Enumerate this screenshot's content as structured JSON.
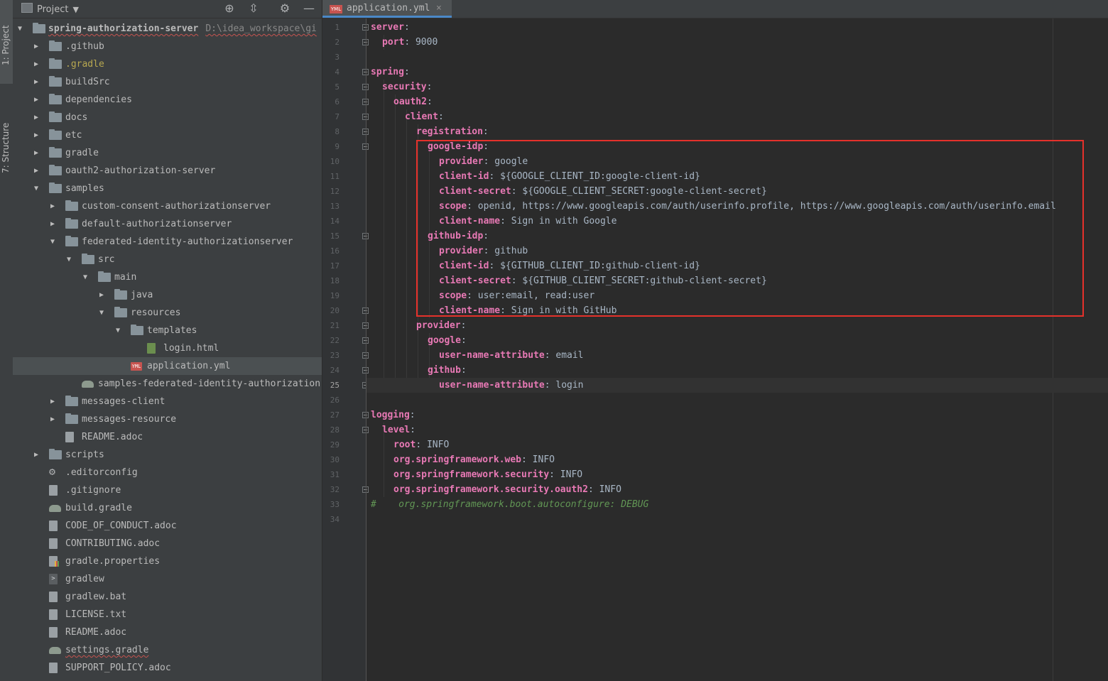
{
  "side_tabs": {
    "project": "1: Project",
    "structure": "7: Structure"
  },
  "project_panel": {
    "title": "Project",
    "root": {
      "name": "spring-authorization-server",
      "path": "D:\\idea_workspace\\gi"
    },
    "tree": [
      {
        "label": ".github"
      },
      {
        "label": ".gradle"
      },
      {
        "label": "buildSrc"
      },
      {
        "label": "dependencies"
      },
      {
        "label": "docs"
      },
      {
        "label": "etc"
      },
      {
        "label": "gradle"
      },
      {
        "label": "oauth2-authorization-server"
      },
      {
        "label": "samples"
      },
      {
        "label": "custom-consent-authorizationserver"
      },
      {
        "label": "default-authorizationserver"
      },
      {
        "label": "federated-identity-authorizationserver"
      },
      {
        "label": "src"
      },
      {
        "label": "main"
      },
      {
        "label": "java"
      },
      {
        "label": "resources"
      },
      {
        "label": "templates"
      },
      {
        "label": "login.html"
      },
      {
        "label": "application.yml"
      },
      {
        "label": "samples-federated-identity-authorization"
      },
      {
        "label": "messages-client"
      },
      {
        "label": "messages-resource"
      },
      {
        "label": "README.adoc"
      },
      {
        "label": "scripts"
      },
      {
        "label": ".editorconfig"
      },
      {
        "label": ".gitignore"
      },
      {
        "label": "build.gradle"
      },
      {
        "label": "CODE_OF_CONDUCT.adoc"
      },
      {
        "label": "CONTRIBUTING.adoc"
      },
      {
        "label": "gradle.properties"
      },
      {
        "label": "gradlew"
      },
      {
        "label": "gradlew.bat"
      },
      {
        "label": "LICENSE.txt"
      },
      {
        "label": "README.adoc"
      },
      {
        "label": "settings.gradle"
      },
      {
        "label": "SUPPORT_POLICY.adoc"
      }
    ]
  },
  "editor": {
    "tab_label": "application.yml",
    "tab_icon_text": "YML",
    "current_line": 25,
    "lines": [
      {
        "n": "1",
        "indent": 0,
        "key": "server",
        "sep": ":",
        "val": ""
      },
      {
        "n": "2",
        "indent": 1,
        "key": "port",
        "sep": ":",
        "val": " 9000"
      },
      {
        "n": "3",
        "indent": 0,
        "key": "",
        "sep": "",
        "val": ""
      },
      {
        "n": "4",
        "indent": 0,
        "key": "spring",
        "sep": ":",
        "val": ""
      },
      {
        "n": "5",
        "indent": 1,
        "key": "security",
        "sep": ":",
        "val": ""
      },
      {
        "n": "6",
        "indent": 2,
        "key": "oauth2",
        "sep": ":",
        "val": ""
      },
      {
        "n": "7",
        "indent": 3,
        "key": "client",
        "sep": ":",
        "val": ""
      },
      {
        "n": "8",
        "indent": 4,
        "key": "registration",
        "sep": ":",
        "val": ""
      },
      {
        "n": "9",
        "indent": 5,
        "key": "google-idp",
        "sep": ":",
        "val": ""
      },
      {
        "n": "10",
        "indent": 6,
        "key": "provider",
        "sep": ":",
        "val": " google"
      },
      {
        "n": "11",
        "indent": 6,
        "key": "client-id",
        "sep": ":",
        "val": " ${GOOGLE_CLIENT_ID:google-client-id}"
      },
      {
        "n": "12",
        "indent": 6,
        "key": "client-secret",
        "sep": ":",
        "val": " ${GOOGLE_CLIENT_SECRET:google-client-secret}"
      },
      {
        "n": "13",
        "indent": 6,
        "key": "scope",
        "sep": ":",
        "val": " openid, https://www.googleapis.com/auth/userinfo.profile, https://www.googleapis.com/auth/userinfo.email"
      },
      {
        "n": "14",
        "indent": 6,
        "key": "client-name",
        "sep": ":",
        "val": " Sign in with Google"
      },
      {
        "n": "15",
        "indent": 5,
        "key": "github-idp",
        "sep": ":",
        "val": ""
      },
      {
        "n": "16",
        "indent": 6,
        "key": "provider",
        "sep": ":",
        "val": " github"
      },
      {
        "n": "17",
        "indent": 6,
        "key": "client-id",
        "sep": ":",
        "val": " ${GITHUB_CLIENT_ID:github-client-id}"
      },
      {
        "n": "18",
        "indent": 6,
        "key": "client-secret",
        "sep": ":",
        "val": " ${GITHUB_CLIENT_SECRET:github-client-secret}"
      },
      {
        "n": "19",
        "indent": 6,
        "key": "scope",
        "sep": ":",
        "val": " user:email, read:user"
      },
      {
        "n": "20",
        "indent": 6,
        "key": "client-name",
        "sep": ":",
        "val": " Sign in with GitHub"
      },
      {
        "n": "21",
        "indent": 4,
        "key": "provider",
        "sep": ":",
        "val": ""
      },
      {
        "n": "22",
        "indent": 5,
        "key": "google",
        "sep": ":",
        "val": ""
      },
      {
        "n": "23",
        "indent": 6,
        "key": "user-name-attribute",
        "sep": ":",
        "val": " email"
      },
      {
        "n": "24",
        "indent": 5,
        "key": "github",
        "sep": ":",
        "val": ""
      },
      {
        "n": "25",
        "indent": 6,
        "key": "user-name-attribute",
        "sep": ":",
        "val": " login"
      },
      {
        "n": "26",
        "indent": 0,
        "key": "",
        "sep": "",
        "val": ""
      },
      {
        "n": "27",
        "indent": 0,
        "key": "logging",
        "sep": ":",
        "val": ""
      },
      {
        "n": "28",
        "indent": 1,
        "key": "level",
        "sep": ":",
        "val": ""
      },
      {
        "n": "29",
        "indent": 2,
        "key": "root",
        "sep": ":",
        "val": " INFO"
      },
      {
        "n": "30",
        "indent": 2,
        "key": "org.springframework.web",
        "sep": ":",
        "val": " INFO"
      },
      {
        "n": "31",
        "indent": 2,
        "key": "org.springframework.security",
        "sep": ":",
        "val": " INFO"
      },
      {
        "n": "32",
        "indent": 2,
        "key": "org.springframework.security.oauth2",
        "sep": ":",
        "val": " INFO"
      },
      {
        "n": "33",
        "indent": 0,
        "key": "",
        "sep": "",
        "val": "",
        "comment": "#    org.springframework.boot.autoconfigure: DEBUG"
      },
      {
        "n": "34",
        "indent": 0,
        "key": "",
        "sep": "",
        "val": ""
      }
    ]
  },
  "colors": {
    "highlight_box": "#e5312b",
    "key": "#cc7832",
    "comment": "#629755"
  }
}
